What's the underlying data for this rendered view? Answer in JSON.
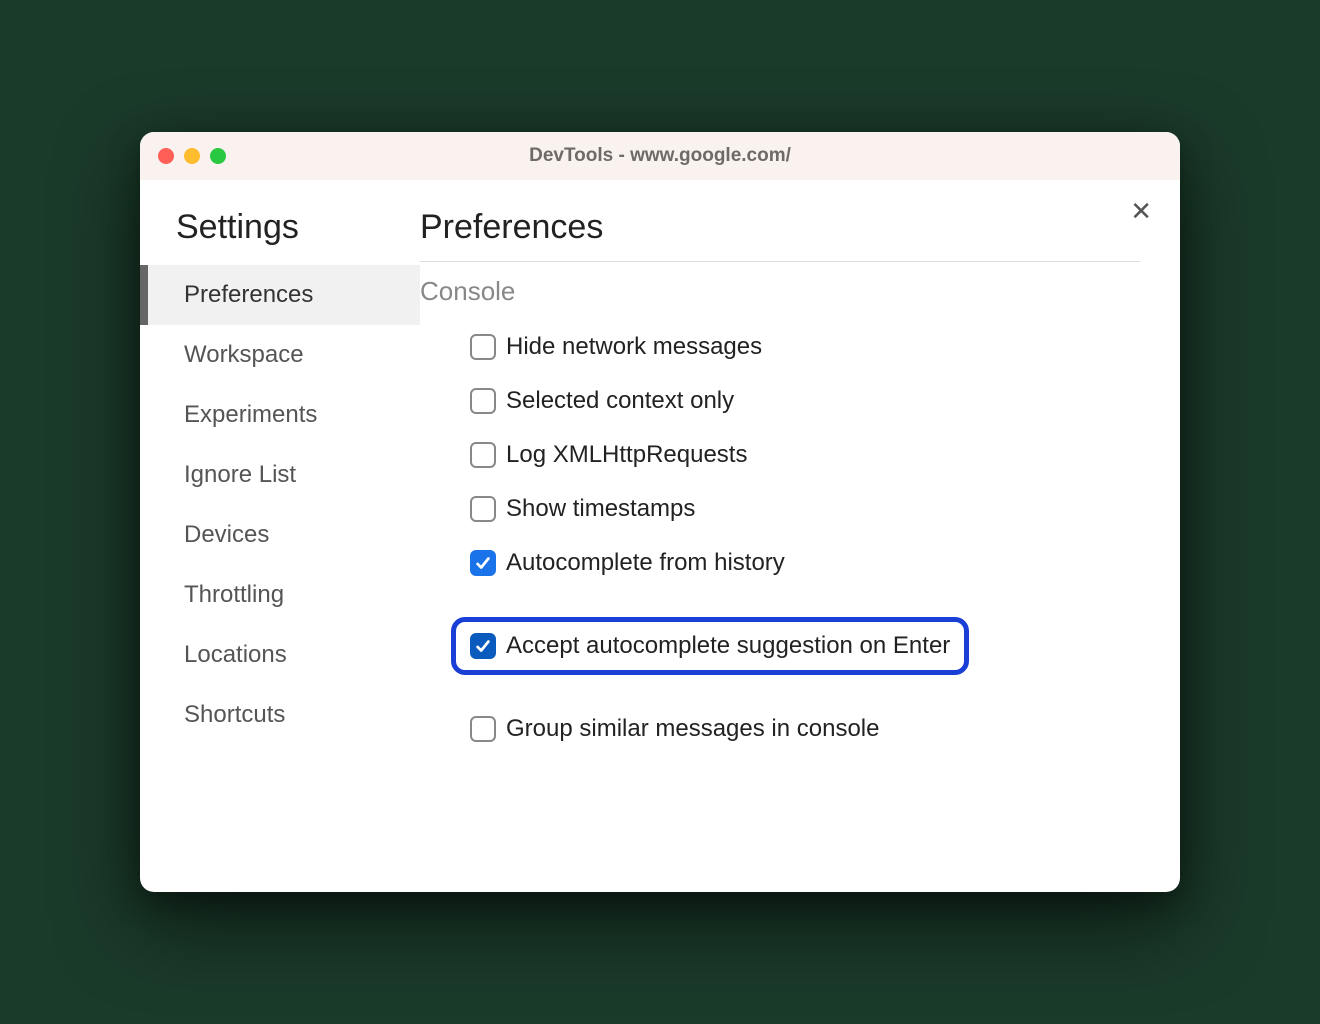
{
  "window": {
    "title": "DevTools - www.google.com/"
  },
  "sidebar": {
    "title": "Settings",
    "items": [
      {
        "label": "Preferences",
        "active": true
      },
      {
        "label": "Workspace",
        "active": false
      },
      {
        "label": "Experiments",
        "active": false
      },
      {
        "label": "Ignore List",
        "active": false
      },
      {
        "label": "Devices",
        "active": false
      },
      {
        "label": "Throttling",
        "active": false
      },
      {
        "label": "Locations",
        "active": false
      },
      {
        "label": "Shortcuts",
        "active": false
      }
    ]
  },
  "main": {
    "title": "Preferences",
    "section_title": "Console",
    "options": [
      {
        "label": "Hide network messages",
        "checked": false,
        "highlighted": false
      },
      {
        "label": "Selected context only",
        "checked": false,
        "highlighted": false
      },
      {
        "label": "Log XMLHttpRequests",
        "checked": false,
        "highlighted": false
      },
      {
        "label": "Show timestamps",
        "checked": false,
        "highlighted": false
      },
      {
        "label": "Autocomplete from history",
        "checked": true,
        "highlighted": false
      },
      {
        "label": "Accept autocomplete suggestion on Enter",
        "checked": true,
        "highlighted": true
      },
      {
        "label": "Group similar messages in console",
        "checked": false,
        "highlighted": false
      }
    ]
  }
}
